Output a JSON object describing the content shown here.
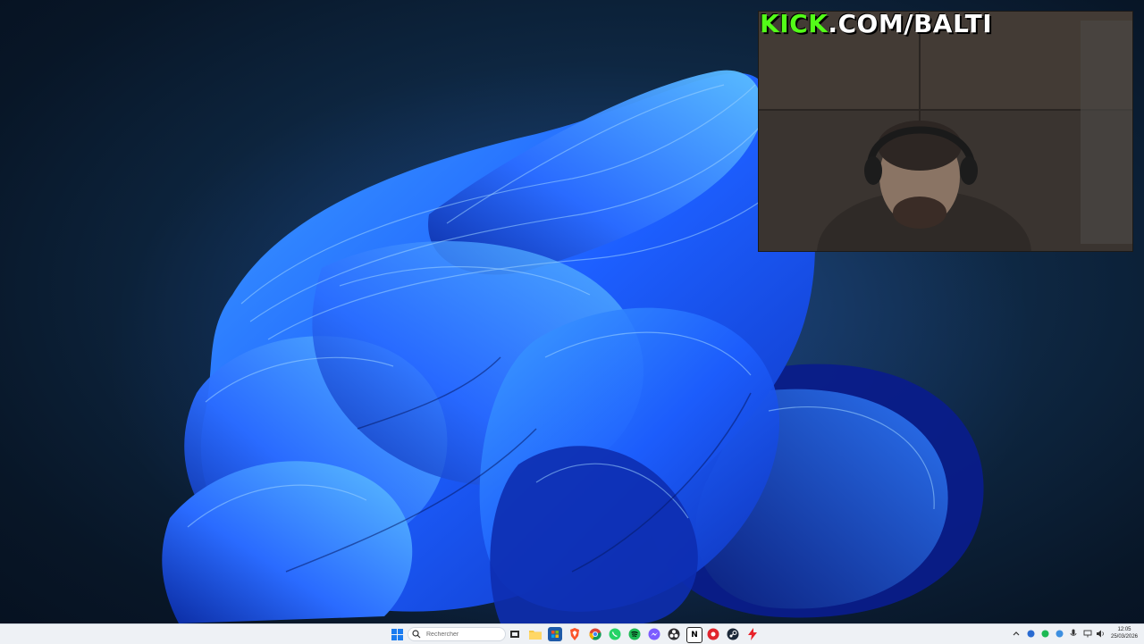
{
  "overlay": {
    "brand_accent": "KICK",
    "brand_rest": ".COM/BALTI",
    "brand_color": "#53fc18"
  },
  "taskbar": {
    "search": {
      "placeholder": "Rechercher"
    },
    "pinned_icons": [
      "windows-start-icon",
      "task-view-icon",
      "file-explorer-icon",
      "store-icon",
      "brave-browser-icon",
      "chrome-icon",
      "whatsapp-icon",
      "spotify-icon",
      "messenger-icon",
      "obs-icon",
      "notion-icon",
      "app-red-icon",
      "steam-icon",
      "app-bolt-icon"
    ],
    "tray_icons": [
      "chevron-up-icon",
      "tray-app-1-icon",
      "tray-app-2-icon",
      "tray-app-3-icon",
      "microphone-icon",
      "network-icon",
      "volume-icon"
    ],
    "clock": {
      "time": "12:05",
      "date": "25/03/2026"
    }
  },
  "colors": {
    "wallpaper_bg": "#0e2742",
    "bloom_blue": "#1f5cff",
    "taskbar_bg": "#eef1f5"
  }
}
